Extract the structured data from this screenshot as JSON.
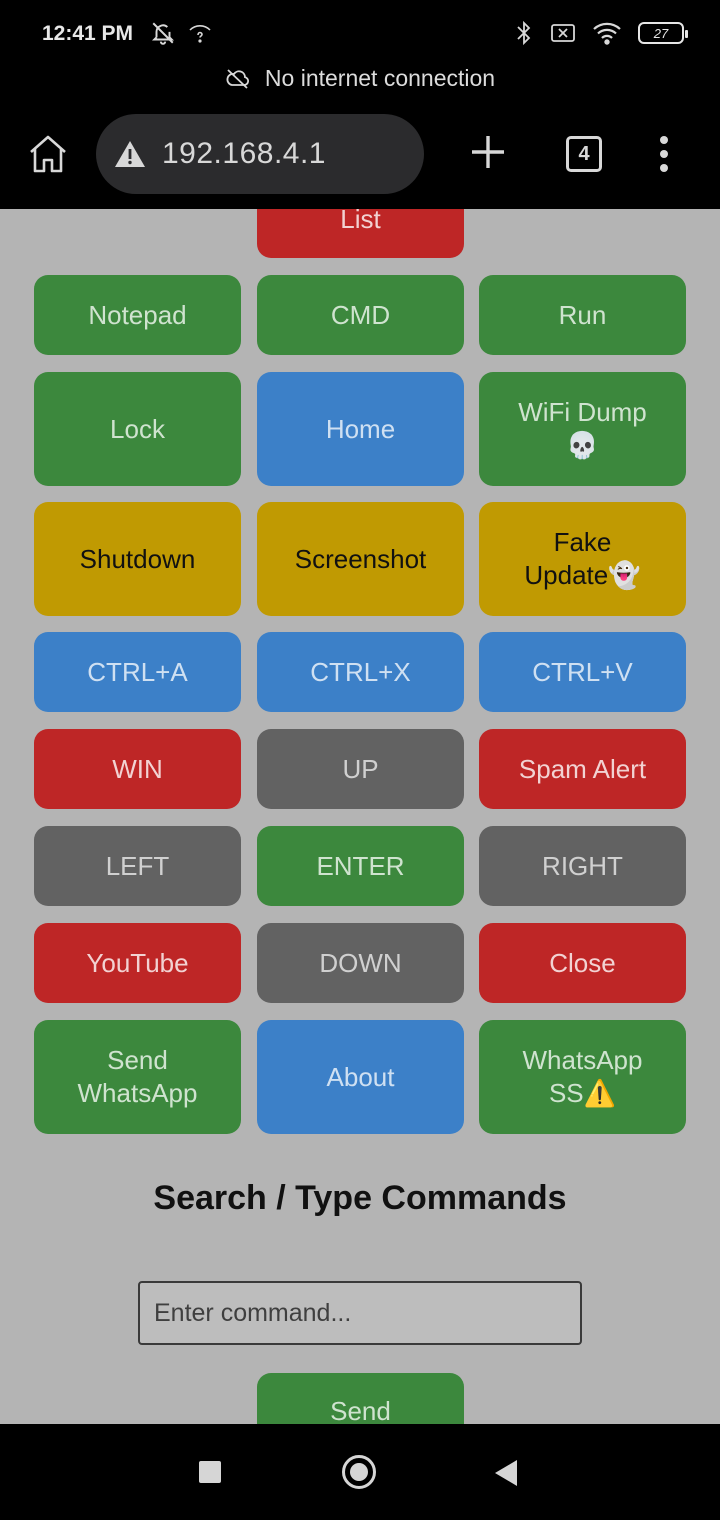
{
  "status_bar": {
    "time": "12:41 PM",
    "battery": "27",
    "icons": [
      "mute-bell-icon",
      "unknown-network-icon",
      "bluetooth-icon",
      "no-sim-icon",
      "wifi-icon",
      "battery-icon"
    ]
  },
  "offline_banner": {
    "text": "No internet connection",
    "icon": "cloud-off-icon"
  },
  "browser": {
    "url": "192.168.4.1",
    "tab_count": "4",
    "icons": [
      "home-icon",
      "warning-icon",
      "plus-icon",
      "tabs-icon",
      "more-vertical-icon"
    ]
  },
  "buttons": {
    "list": "List",
    "notepad": "Notepad",
    "cmd": "CMD",
    "run": "Run",
    "lock": "Lock",
    "home": "Home",
    "wifi_dump": "WiFi Dump 💀",
    "shutdown": "Shutdown",
    "screenshot": "Screenshot",
    "fake_update": "Fake Update👻",
    "ctrl_a": "CTRL+A",
    "ctrl_x": "CTRL+X",
    "ctrl_v": "CTRL+V",
    "win": "WIN",
    "up": "UP",
    "spam_alert": "Spam Alert",
    "left": "LEFT",
    "enter": "ENTER",
    "right": "RIGHT",
    "youtube": "YouTube",
    "down": "DOWN",
    "close": "Close",
    "send_whatsapp": "Send WhatsApp",
    "about": "About",
    "whatsapp_ss": "WhatsApp SS⚠️",
    "send": "Send"
  },
  "command_section": {
    "heading": "Search / Type Commands",
    "input_value": "",
    "input_placeholder": "Enter command..."
  },
  "colors": {
    "green": "#3c883d",
    "blue": "#3c80c8",
    "yellow": "#c09a02",
    "red": "#be2626",
    "gray": "#626262",
    "page_bg": "#b4b4b4"
  }
}
